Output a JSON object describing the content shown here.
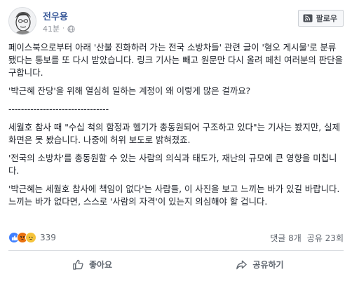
{
  "post": {
    "author": "전우용",
    "time": "41분",
    "follow_label": "팔로우",
    "paragraphs": [
      "페이스북으로부터 아래 '산불 진화하러 가는 전국 소방차들' 관련 글이 '혐오 게시물'로 분류됐다는 통보를 또 다시 받았습니다. 링크 기사는 빼고 원문만 다시 올려 페친 여러분의 판단을 구합니다.",
      "'박근혜 잔당'을 위해 열심히 일하는 계정이 왜 이렇게 많은 걸까요?",
      "--------------------------------",
      "세월호 참사 때 \"수십 척의 함정과 헬기가 총동원되어 구조하고 있다\"는 기사는 봤지만, 실제 화면은 못 봤습니다. 나중에 허위 보도로 밝혀졌죠.",
      "'전국의 소방차'를 총동원할 수 있는 사람의 의식과 태도가, 재난의 규모에 큰 영향을 미칩니다.",
      "'박근혜는 세월호 참사에 책임이 없다'는 사람들, 이 사진을 보고 느끼는 바가 있길 바랍니다. 느끼는 바가 없다면, 스스로 '사람의 자격'이 있는지 의심해야 할 겁니다."
    ],
    "reaction_count": "339",
    "comments": "댓글 8개",
    "shares": "공유 23회",
    "reactions": [
      "like",
      "angry",
      "sad"
    ]
  },
  "actions": {
    "like_label": "좋아요",
    "share_label": "공유하기"
  },
  "colors": {
    "author": "#385898",
    "meta": "#90949c",
    "like": "#4080ff",
    "angry": "#e9710f",
    "sad": "#f5c33b"
  },
  "icons": {
    "avatar": "caricature-avatar",
    "globe": "globe-icon",
    "follow": "rss-follow-icon",
    "like": "thumbs-up-icon",
    "share": "share-arrow-icon"
  }
}
